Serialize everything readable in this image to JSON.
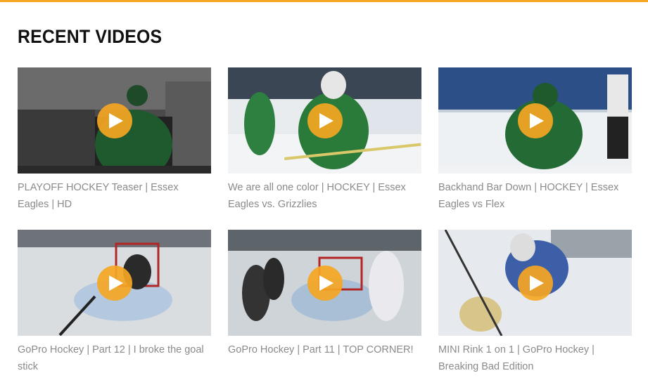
{
  "section": {
    "title": "RECENT VIDEOS"
  },
  "colors": {
    "accent": "#f5a623",
    "caption": "#8a8a8a",
    "title": "#111111"
  },
  "videos": [
    {
      "caption": "PLAYOFF HOCKEY Teaser | Essex Eagles | HD",
      "icon": "play-icon"
    },
    {
      "caption": "We are all one color | HOCKEY | Essex Eagles vs. Grizzlies",
      "icon": "play-icon"
    },
    {
      "caption": "Backhand Bar Down | HOCKEY | Essex Eagles vs Flex",
      "icon": "play-icon"
    },
    {
      "caption": "GoPro Hockey | Part 12 | I broke the goal stick",
      "icon": "play-icon"
    },
    {
      "caption": "GoPro Hockey | Part 11 | TOP CORNER!",
      "icon": "play-icon"
    },
    {
      "caption": "MINI Rink 1 on 1 | GoPro Hockey | Breaking Bad Edition",
      "icon": "play-icon"
    }
  ]
}
